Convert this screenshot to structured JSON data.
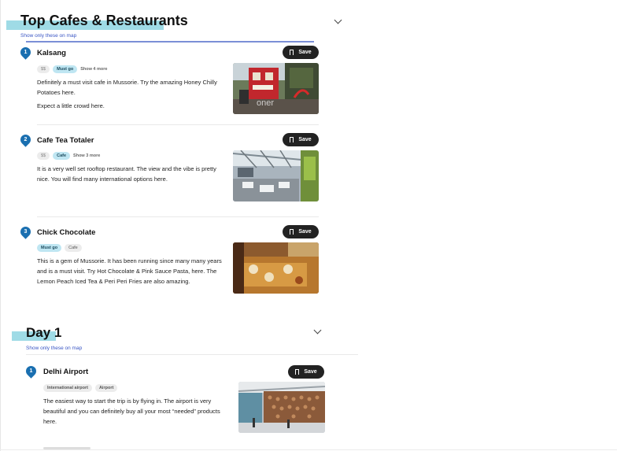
{
  "sections": [
    {
      "title": "Top Cafes & Restaurants",
      "show_map_link": "Show only these on map",
      "places": [
        {
          "number": "1",
          "name": "Kalsang",
          "save_label": "Save",
          "price": "$$",
          "tags": [
            "Must go"
          ],
          "show_more": "Show 4 more",
          "description": [
            "Definitely a must visit cafe in Mussorie. Try the amazing Honey Chilly Potatoes here.",
            "Expect a little crowd here."
          ],
          "photo_caption": "oner"
        },
        {
          "number": "2",
          "name": "Cafe Tea Totaler",
          "save_label": "Save",
          "price": "$$",
          "tags": [
            "Cafe"
          ],
          "show_more": "Show 3 more",
          "description": [
            "It is a very well set rooftop restaurant. The view and the vibe is pretty nice. You will find many international options here."
          ]
        },
        {
          "number": "3",
          "name": "Chick Chocolate",
          "save_label": "Save",
          "tags": [
            "Must go",
            "Cafe"
          ],
          "description": [
            "This is a gem of Mussorie. It has been running since many many years and is a must visit. Try Hot Chocolate & Pink Sauce Pasta, here. The Lemon Peach Iced Tea & Peri Peri Fries are also amazing."
          ]
        }
      ]
    },
    {
      "title": "Day 1",
      "show_map_link": "Show only these on map",
      "places": [
        {
          "number": "1",
          "name": "Delhi Airport",
          "save_label": "Save",
          "tags": [
            "International airport",
            "Airport"
          ],
          "description": [
            "The easiest way to start the trip is by flying in. The airport is very beautiful and you can definitely buy all your most “needed” products here."
          ]
        }
      ]
    }
  ],
  "colors": {
    "highlight": "#9fdbe6",
    "pin": "#1a6fb0",
    "link": "#3a56c4",
    "save_button": "#222222",
    "tag_blue": "#bfe6f2"
  }
}
